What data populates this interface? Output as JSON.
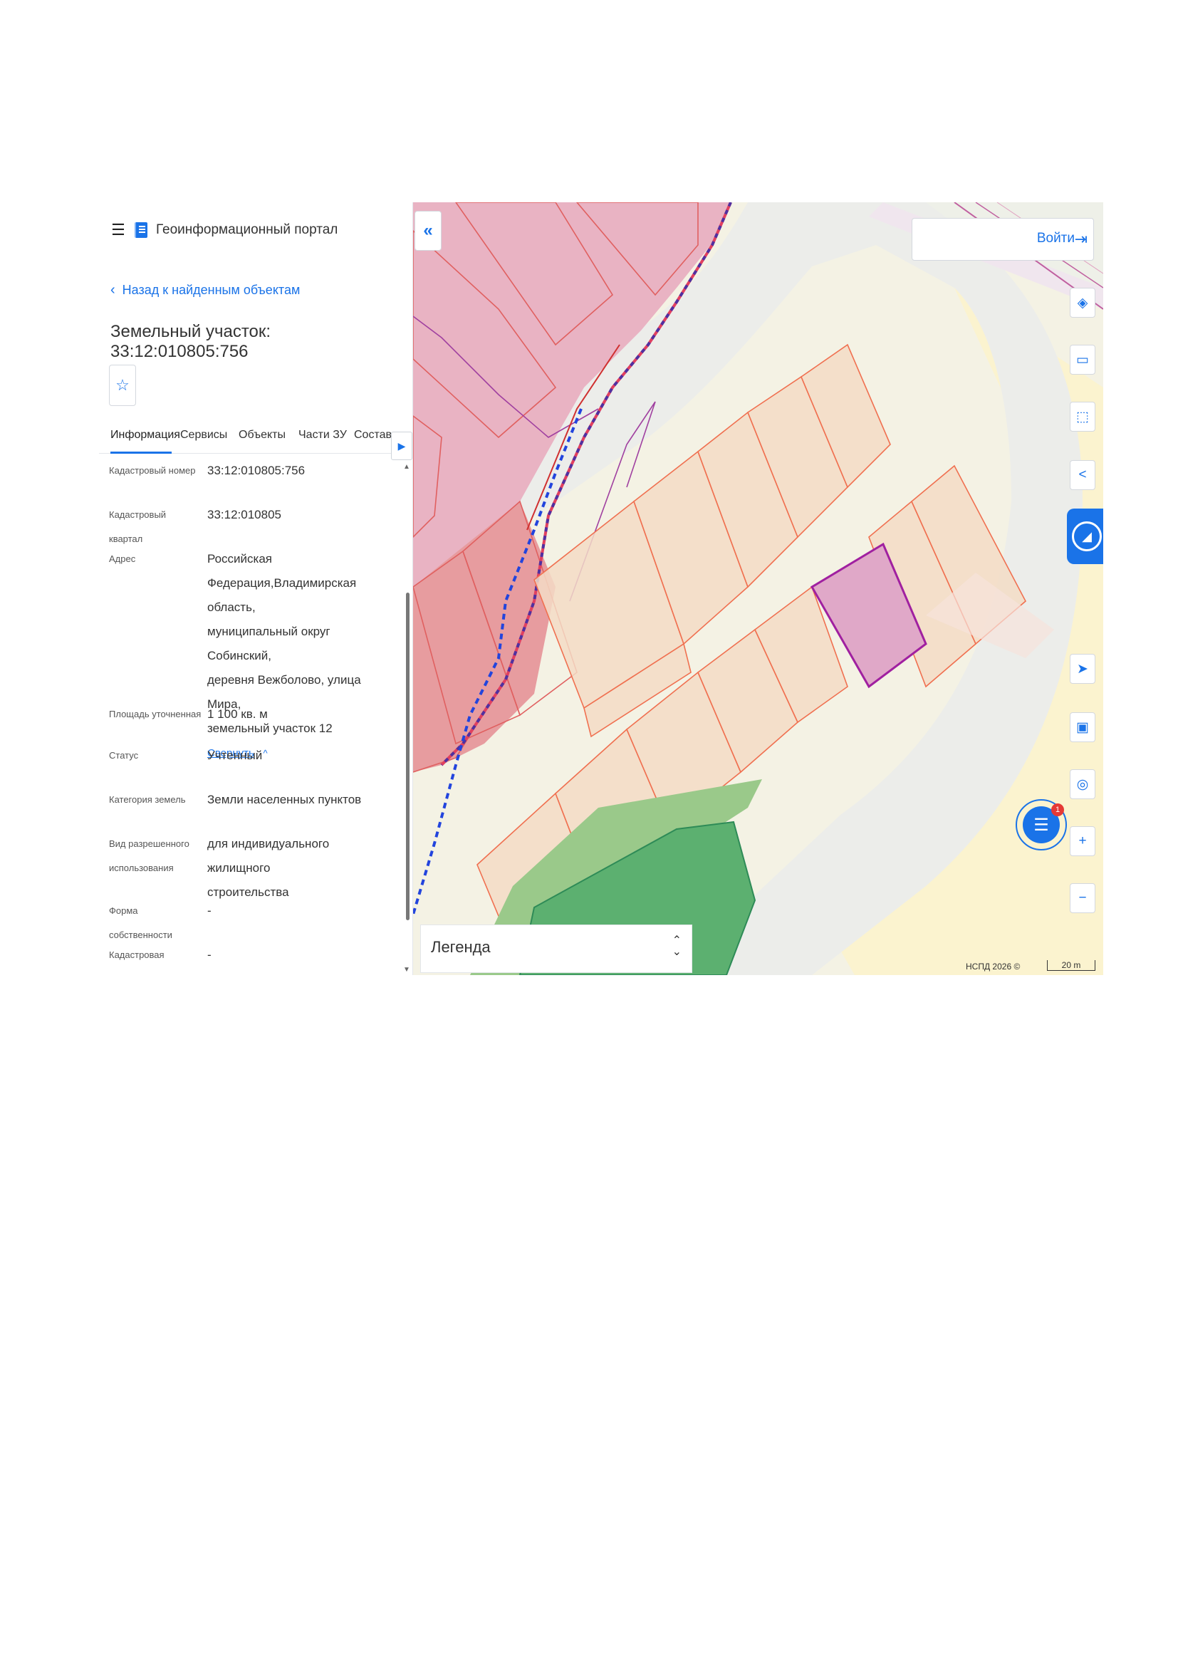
{
  "header": {
    "app_title": "Геоинформационный портал",
    "menu_icon": "hamburger-icon",
    "logo_icon": "portal-logo-icon"
  },
  "back_link": {
    "label": "Назад к найденным объектам"
  },
  "page_title": "Земельный участок: 33:12:010805:756",
  "tabs": [
    {
      "label": "Информация"
    },
    {
      "label": "Сервисы"
    },
    {
      "label": "Объекты"
    },
    {
      "label": "Части ЗУ"
    },
    {
      "label": "Состав"
    }
  ],
  "fields": [
    {
      "label": "Кадастровый номер",
      "value": "33:12:010805:756"
    },
    {
      "label": "Кадастровый квартал",
      "value": "33:12:010805"
    },
    {
      "label": "Адрес",
      "value_lines": [
        "Российская",
        "Федерация,Владимирская область,",
        "муниципальный округ Собинский,",
        "деревня Вежболово, улица Мира,",
        "земельный участок 12"
      ],
      "action": "Свернуть"
    },
    {
      "label": "Площадь уточненная",
      "value": "1 100 кв. м"
    },
    {
      "label": "Статус",
      "value": "Учтенный"
    },
    {
      "label": "Категория земель",
      "value": "Земли населенных пунктов"
    },
    {
      "label_lines": [
        "Вид разрешенного",
        "использования"
      ],
      "value_lines": [
        "для индивидуального жилищного",
        "строительства"
      ]
    },
    {
      "label": "Форма собственности",
      "value": "-"
    },
    {
      "label": "Кадастровая",
      "value": "-"
    }
  ],
  "map": {
    "login_label": "Войти",
    "legend_label": "Легенда",
    "attribution": "НСПД 2026 ©",
    "scale_label": "20 m",
    "chat_badge": "1",
    "colors": {
      "accent": "#1a73e8",
      "selected_parcel": "#a020a0",
      "parcel_stroke": "#f07050",
      "red_zone": "#e0707a",
      "green_zone": "#4caf50",
      "boundary_dashed": "#2244dd"
    }
  }
}
